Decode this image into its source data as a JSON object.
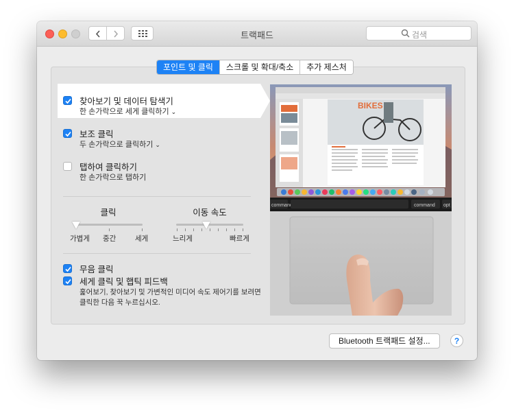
{
  "window": {
    "title": "트랙패드"
  },
  "search": {
    "placeholder": "검색"
  },
  "tabs": [
    {
      "label": "포인트 및 클릭",
      "active": true
    },
    {
      "label": "스크롤 및 확대/축소",
      "active": false
    },
    {
      "label": "추가 제스처",
      "active": false
    }
  ],
  "options": {
    "lookup": {
      "label": "찾아보기 및 데이터 탐색기",
      "sub": "한 손가락으로 세게 클릭하기",
      "checked": true
    },
    "secondary": {
      "label": "보조 클릭",
      "sub": "두 손가락으로 클릭하기",
      "checked": true
    },
    "tap": {
      "label": "탭하여 클릭하기",
      "sub": "한 손가락으로 탭하기",
      "checked": false
    },
    "silent": {
      "label": "무음 클릭",
      "checked": true
    },
    "force": {
      "label": "세게 클릭 및 햅틱 피드백",
      "checked": true,
      "note": "훑어보기, 찾아보기 및 가변적인 미디어 속도 제어기를 보려면 클릭한 다음 꾹 누르십시오."
    }
  },
  "sliders": {
    "click": {
      "title": "클릭",
      "labels": [
        "가볍게",
        "중간",
        "세게"
      ],
      "value_fraction": 0.0
    },
    "speed": {
      "title": "이동 속도",
      "min_label": "느리게",
      "max_label": "빠르게",
      "value_fraction": 0.45
    }
  },
  "preview": {
    "brand": "BIKES",
    "key_left": "command",
    "key_right": "command",
    "key_opt": "opt"
  },
  "buttons": {
    "bluetooth": "Bluetooth 트랙패드 설정...",
    "help": "?"
  },
  "colors": {
    "accent": "#1d82f5",
    "window_bg": "#ececec"
  }
}
